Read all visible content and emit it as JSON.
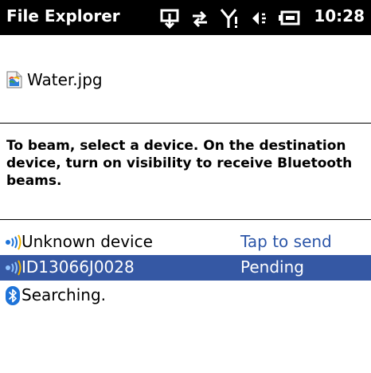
{
  "titlebar": {
    "app_title": "File Explorer",
    "clock": "10:28",
    "status_icons": [
      "data-connection-icon",
      "sync-arrows-icon",
      "signal-strength-icon",
      "volume-icon",
      "battery-charging-icon"
    ]
  },
  "file": {
    "name": "Water.jpg",
    "icon": "image-file-icon"
  },
  "instructions": "To beam, select a device. On the destination device, turn on visibility to receive Bluetooth beams.",
  "devices": [
    {
      "name": "Unknown device",
      "status": "Tap to send",
      "selected": false,
      "icon": "beam-signal-icon"
    },
    {
      "name": "ID13066J0028",
      "status": "Pending",
      "selected": true,
      "icon": "beam-signal-icon"
    }
  ],
  "search": {
    "label": "Searching.",
    "icon": "bluetooth-icon"
  },
  "colors": {
    "titlebar_bg": "#000000",
    "selection_bg": "#3558a4",
    "link_text": "#2c56a8",
    "bluetooth_blue": "#1e73d8"
  }
}
